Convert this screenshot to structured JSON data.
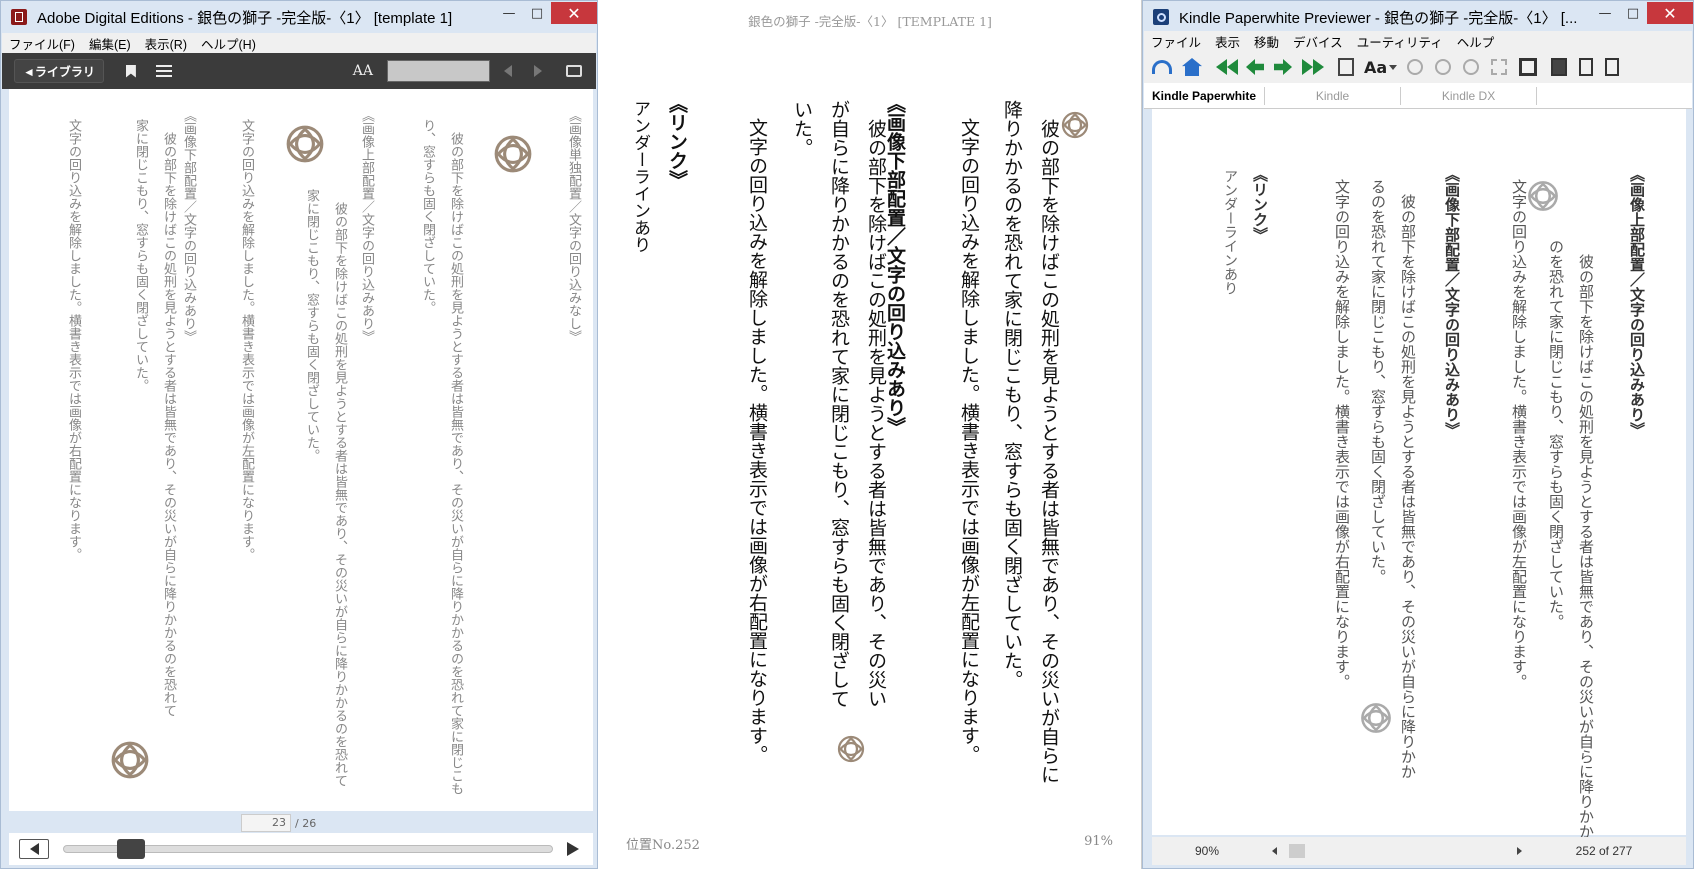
{
  "ade": {
    "title": "Adobe Digital Editions - 銀色の獅子 -完全版-〈1〉 [template 1]",
    "menu": [
      "ファイル(F)",
      "編集(E)",
      "表示(R)",
      "ヘルプ(H)"
    ],
    "library_label": "◄ライブラリ",
    "font_label": "AA",
    "page_current": "23",
    "page_total": "/ 26",
    "columns": [
      "《画像単独配置／文字の回り込みなし》",
      "　彼の部下を除けばこの処刑を見ようとする者は皆無であり、その災いが自らに降りかかるのを恐れて家に閉じこもり、窓すらも固く閉ざしていた。",
      "《画像上部配置／文字の回り込みあり》",
      "　彼の部下を除けばこの処刑を見ようとする者は皆無であり、その災いが自らに降りかかるのを恐れて家に閉じこもり、窓すらも固く閉ざしていた。",
      "文字の回り込みを解除しました。横書き表示では画像が左配置になります。",
      "《画像下部配置／文字の回り込みあり》",
      "　彼の部下を除けばこの処刑を見ようとする者は皆無であり、その災いが自らに降りかかるのを恐れて家に閉じこもり、窓すらも固く閉ざしていた。",
      "文字の回り込みを解除しました。横書き表示では画像が右配置になります。"
    ]
  },
  "mid": {
    "header": "銀色の獅子 -完全版-〈1〉 [TEMPLATE 1]",
    "col1": "　彼の部下を除けばこの処刑を見ようとする者は皆無であり、その災いが自らに降りかかるのを恐れて家に閉じこもり、窓すらも固く閉ざしていた。",
    "col2": "文字の回り込みを解除しました。横書き表示では画像が左配置になります。",
    "heading1": "《画像下部配置／文字の回り込みあり》",
    "col3": "　彼の部下を除けばこの処刑を見ようとする者は皆無であり、その災いが自らに降りかかるのを恐れて家に閉じこもり、窓すらも固く閉ざしていた。",
    "col4": "文字の回り込みを解除しました。横書き表示では画像が右配置になります。",
    "heading2": "《リンク》",
    "col5": "アンダーラインあり",
    "footer_left": "位置No.252",
    "footer_right": "91%"
  },
  "kpw": {
    "title": "Kindle Paperwhite Previewer - 銀色の獅子 -完全版-〈1〉 [...",
    "menu": [
      "ファイル",
      "表示",
      "移動",
      "デバイス",
      "ユーティリティ",
      "ヘルプ"
    ],
    "font_label": "Aa",
    "tabs": [
      "Kindle Paperwhite",
      "Kindle",
      "Kindle DX"
    ],
    "heading1": "《画像上部配置／文字の回り込みあり》",
    "col1": "　彼の部下を除けばこの処刑を見ようとする者は皆無であり、その災いが自らに降りかかるのを恐れて家に閉じこもり、窓すらも固く閉ざしていた。",
    "col2": "文字の回り込みを解除しました。横書き表示では画像が左配置になります。",
    "heading2": "《画像下部配置／文字の回り込みあり》",
    "col3": "　彼の部下を除けばこの処刑を見ようとする者は皆無であり、その災いが自らに降りかかるのを恐れて家に閉じこもり、窓すらも固く閉ざしていた。",
    "col4": "文字の回り込みを解除しました。横書き表示では画像が右配置になります。",
    "heading3": "《リンク》",
    "col5": "アンダーラインあり",
    "zoom": "90%",
    "position": "252 of 277"
  }
}
